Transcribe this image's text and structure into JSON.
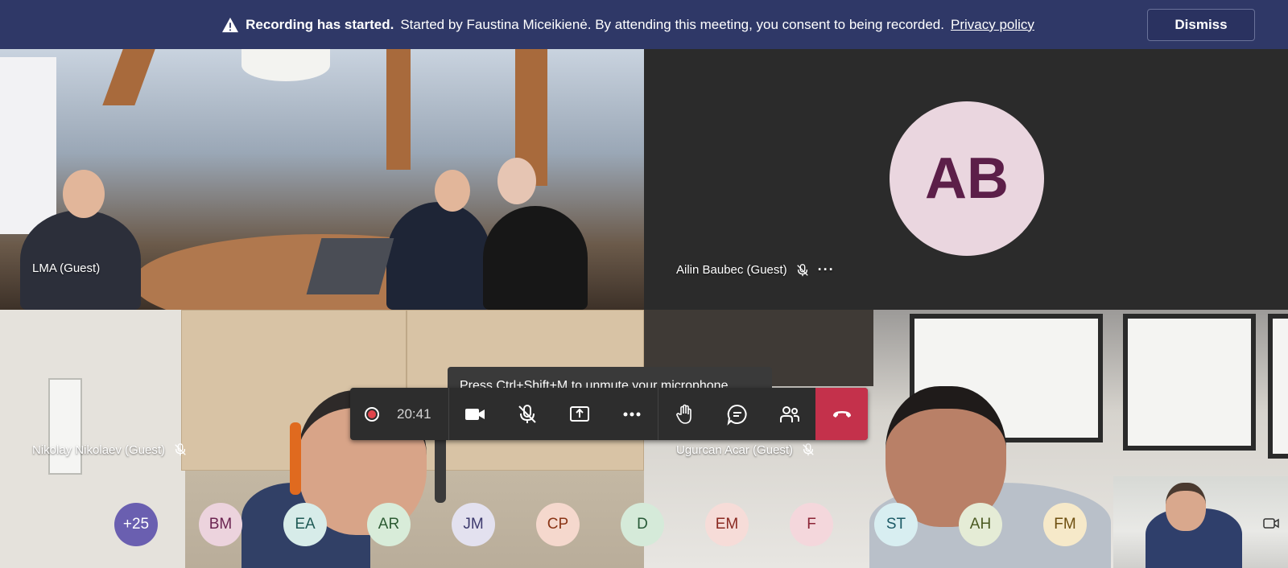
{
  "banner": {
    "title": "Recording has started.",
    "message": "Started by Faustina Miceikienė. By attending this meeting, you consent to being recorded.",
    "link": "Privacy policy",
    "dismiss_label": "Dismiss"
  },
  "tiles": [
    {
      "name": "LMA (Guest)"
    },
    {
      "name": "Ailin Baubec (Guest)",
      "initials": "AB",
      "more": "···"
    },
    {
      "name": "Nikolay Nikolaev (Guest)"
    },
    {
      "name": "Ugurcan Acar (Guest)"
    }
  ],
  "tooltip": "Press Ctrl+Shift+M to unmute your microphone",
  "callbar": {
    "timer": "20:41"
  },
  "participants": [
    {
      "initials": "+25",
      "bg": "#6a5fb0",
      "fg": "#ffffff"
    },
    {
      "initials": "BM",
      "bg": "#ecd3dd",
      "fg": "#6b2451"
    },
    {
      "initials": "EA",
      "bg": "#d7ece9",
      "fg": "#1f5a55"
    },
    {
      "initials": "AR",
      "bg": "#d8ecd9",
      "fg": "#2c5b33"
    },
    {
      "initials": "JM",
      "bg": "#e3e1ef",
      "fg": "#3d3a6e"
    },
    {
      "initials": "CP",
      "bg": "#f5d8cd",
      "fg": "#8a3516"
    },
    {
      "initials": "D",
      "bg": "#d5ead9",
      "fg": "#275a37"
    },
    {
      "initials": "EM",
      "bg": "#f6dcd8",
      "fg": "#8a2a22"
    },
    {
      "initials": "F",
      "bg": "#f4d7dc",
      "fg": "#8b2436"
    },
    {
      "initials": "ST",
      "bg": "#d8eef1",
      "fg": "#1c5a66"
    },
    {
      "initials": "AH",
      "bg": "#e5ecd6",
      "fg": "#4b5a22"
    },
    {
      "initials": "FM",
      "bg": "#f6e9c9",
      "fg": "#6e4f10"
    }
  ],
  "colors": {
    "banner_bg": "#2f3867",
    "hangup": "#c4314b",
    "record": "#e0444b"
  }
}
